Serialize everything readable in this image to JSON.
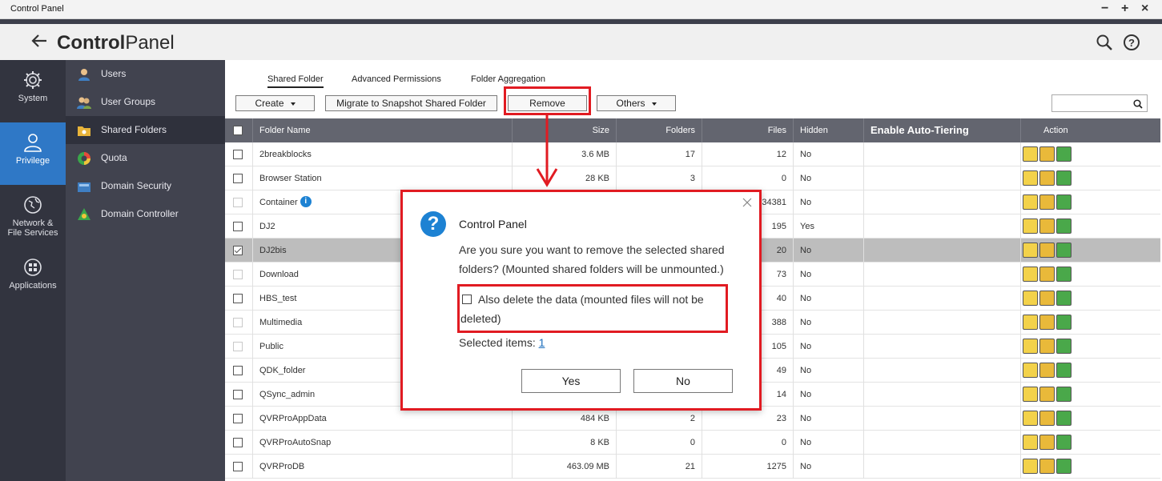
{
  "window": {
    "title": "Control Panel",
    "minimize": "−",
    "maximize": "+",
    "close": "×"
  },
  "header": {
    "title_bold": "Control",
    "title_light": "Panel",
    "search_icon": "search-icon",
    "help_icon": "help-icon"
  },
  "rail": [
    {
      "label": "System",
      "icon": "gear-icon"
    },
    {
      "label": "Privilege",
      "icon": "user-icon",
      "active": true
    },
    {
      "label": "Network &\nFile Services",
      "icon": "globe-icon"
    },
    {
      "label": "Applications",
      "icon": "apps-grid-icon"
    }
  ],
  "rail_labels": {
    "system": "System",
    "privilege": "Privilege",
    "network1": "Network &",
    "network2": "File Services",
    "applications": "Applications"
  },
  "submenu": [
    {
      "label": "Users",
      "icon": "user-icon"
    },
    {
      "label": "User Groups",
      "icon": "user-group-icon"
    },
    {
      "label": "Shared Folders",
      "icon": "shared-folder-icon",
      "active": true
    },
    {
      "label": "Quota",
      "icon": "quota-pie-icon"
    },
    {
      "label": "Domain Security",
      "icon": "domain-security-icon"
    },
    {
      "label": "Domain Controller",
      "icon": "domain-controller-icon"
    }
  ],
  "tabs": [
    "Shared Folder",
    "Advanced Permissions",
    "Folder Aggregation"
  ],
  "toolbar": {
    "create": "Create",
    "migrate": "Migrate to Snapshot Shared Folder",
    "remove": "Remove",
    "others": "Others"
  },
  "columns": [
    "Folder Name",
    "Size",
    "Folders",
    "Files",
    "Hidden",
    "Enable Auto-Tiering",
    "Action"
  ],
  "rows": [
    {
      "name": "2breakblocks",
      "size": "3.6 MB",
      "folders": "17",
      "files": "12",
      "hidden": "No"
    },
    {
      "name": "Browser Station",
      "size": "28 KB",
      "folders": "3",
      "files": "0",
      "hidden": "No"
    },
    {
      "name": "Container",
      "size": "",
      "folders": "",
      "files": "34381",
      "hidden": "No",
      "info": "i"
    },
    {
      "name": "DJ2",
      "size": "",
      "folders": "",
      "files": "195",
      "hidden": "Yes"
    },
    {
      "name": "DJ2bis",
      "size": "",
      "folders": "",
      "files": "20",
      "hidden": "No"
    },
    {
      "name": "Download",
      "size": "",
      "folders": "",
      "files": "73",
      "hidden": "No"
    },
    {
      "name": "HBS_test",
      "size": "",
      "folders": "",
      "files": "40",
      "hidden": "No"
    },
    {
      "name": "Multimedia",
      "size": "",
      "folders": "",
      "files": "388",
      "hidden": "No"
    },
    {
      "name": "Public",
      "size": "",
      "folders": "",
      "files": "105",
      "hidden": "No"
    },
    {
      "name": "QDK_folder",
      "size": "",
      "folders": "",
      "files": "49",
      "hidden": "No"
    },
    {
      "name": "QSync_admin",
      "size": "",
      "folders": "",
      "files": "14",
      "hidden": "No"
    },
    {
      "name": "QVRProAppData",
      "size": "484 KB",
      "folders": "2",
      "files": "23",
      "hidden": "No"
    },
    {
      "name": "QVRProAutoSnap",
      "size": "8 KB",
      "folders": "0",
      "files": "0",
      "hidden": "No"
    },
    {
      "name": "QVRProDB",
      "size": "463.09 MB",
      "folders": "21",
      "files": "1275",
      "hidden": "No"
    }
  ],
  "dialog": {
    "title": "Control Panel",
    "message": "Are you sure you want to remove the selected shared folders? (Mounted shared folders will be unmounted.)",
    "option": "Also delete the data (mounted files will not be deleted)",
    "selected_label": "Selected items: ",
    "selected_count": "1",
    "yes": "Yes",
    "no": "No"
  },
  "colors": {
    "accent": "#2f78c6",
    "rail_bg": "#32343f",
    "submenu_bg": "#41434f",
    "table_header": "#63656f",
    "annotation": "#e11b22"
  }
}
